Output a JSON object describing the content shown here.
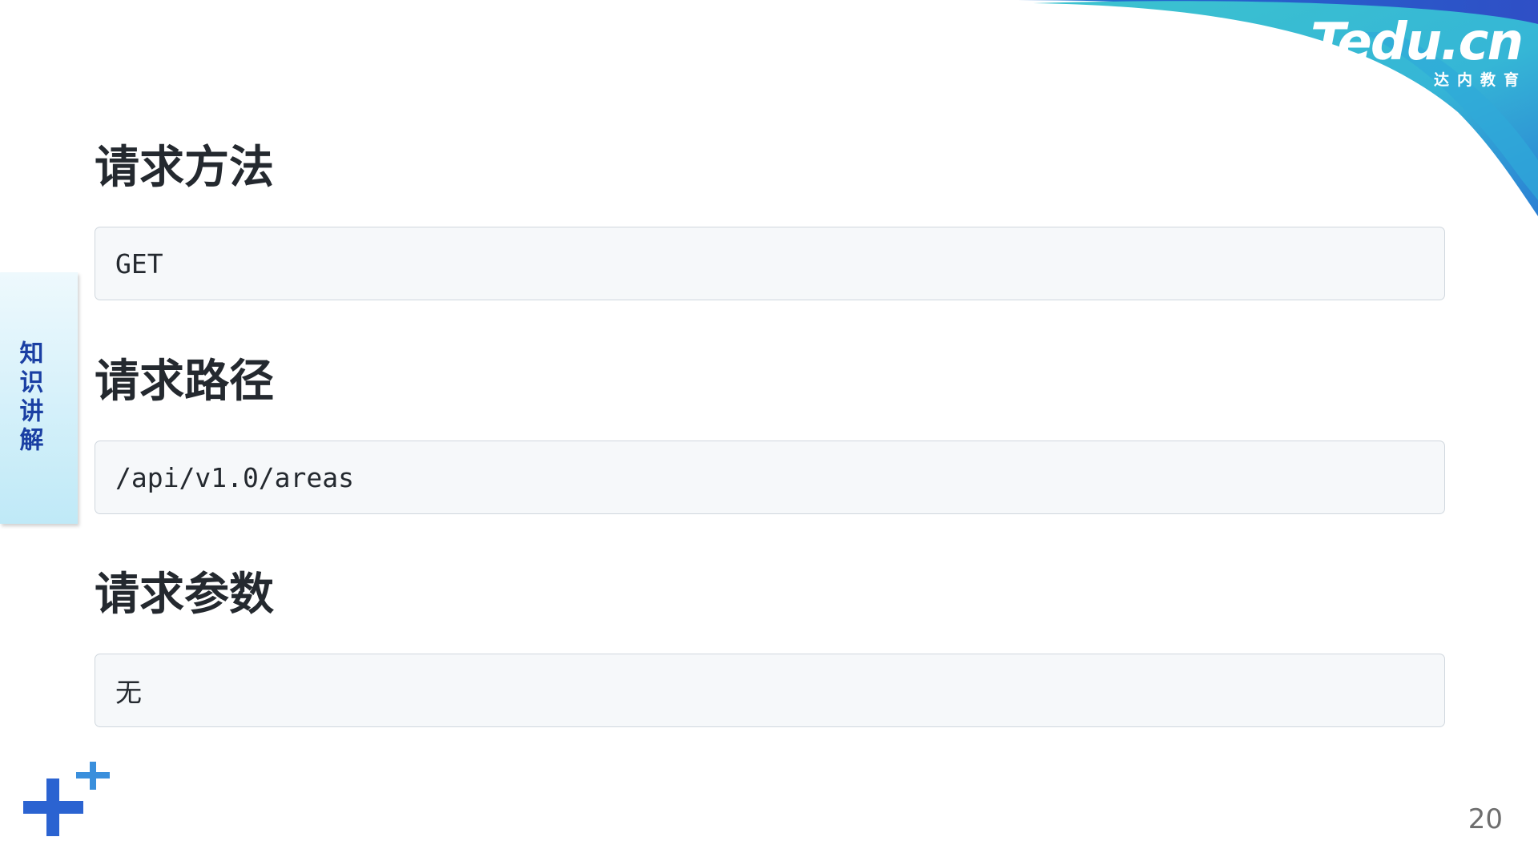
{
  "logo": {
    "main": "Tedu.cn",
    "sub": "达内教育"
  },
  "side_tab": {
    "label": "知识讲解"
  },
  "sections": [
    {
      "title": "请求方法",
      "value": "GET"
    },
    {
      "title": "请求路径",
      "value": "/api/v1.0/areas"
    },
    {
      "title": "请求参数",
      "value": "无"
    }
  ],
  "page_number": "20",
  "colors": {
    "title_text": "#24292f",
    "code_bg": "#f6f8fa",
    "code_border": "#d0d7de",
    "side_tab_text": "#1a3fa3",
    "swoosh_teal": "#3cc3cf",
    "swoosh_blue": "#2f6fd6",
    "plus_blue": "#2b63d1"
  },
  "icons": [
    "corner-swoosh",
    "plus-decoration-icon"
  ]
}
